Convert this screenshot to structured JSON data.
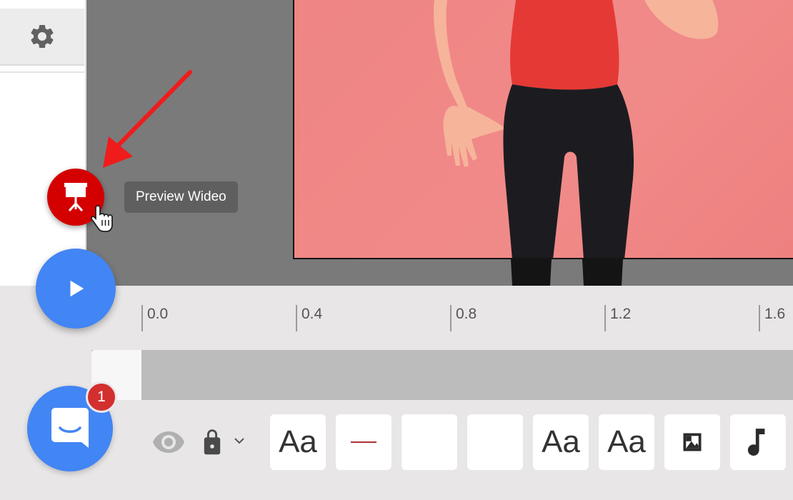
{
  "sidebar": {
    "settings_icon": "gear-icon"
  },
  "preview_button": {
    "icon": "presentation-icon",
    "tooltip": "Preview Wideo"
  },
  "play_button": {
    "icon": "play-icon"
  },
  "chat_button": {
    "icon": "chat-icon",
    "badge_count": "1"
  },
  "timeline": {
    "ruler_labels": [
      "0.0",
      "0.4",
      "0.8",
      "1.2",
      "1.6"
    ]
  },
  "toolbar": {
    "visibility_icon": "eye-icon",
    "lock_icon": "lock-icon",
    "lock_menu_icon": "chevron-down-icon",
    "tools": [
      {
        "label": "Aa",
        "icon": "text-style-icon"
      },
      {
        "label": "",
        "icon": "line-icon"
      },
      {
        "label": "",
        "icon": "blank-icon"
      },
      {
        "label": "",
        "icon": "blank-icon"
      },
      {
        "label": "Aa",
        "icon": "text-style-icon"
      },
      {
        "label": "Aa",
        "icon": "text-style-icon"
      },
      {
        "label": "",
        "icon": "image-icon"
      },
      {
        "label": "",
        "icon": "music-note-icon"
      }
    ]
  },
  "colors": {
    "accent_blue": "#4285f4",
    "preview_red": "#d40000",
    "badge_red": "#d32f2f",
    "scene_background": "#ef8585"
  }
}
